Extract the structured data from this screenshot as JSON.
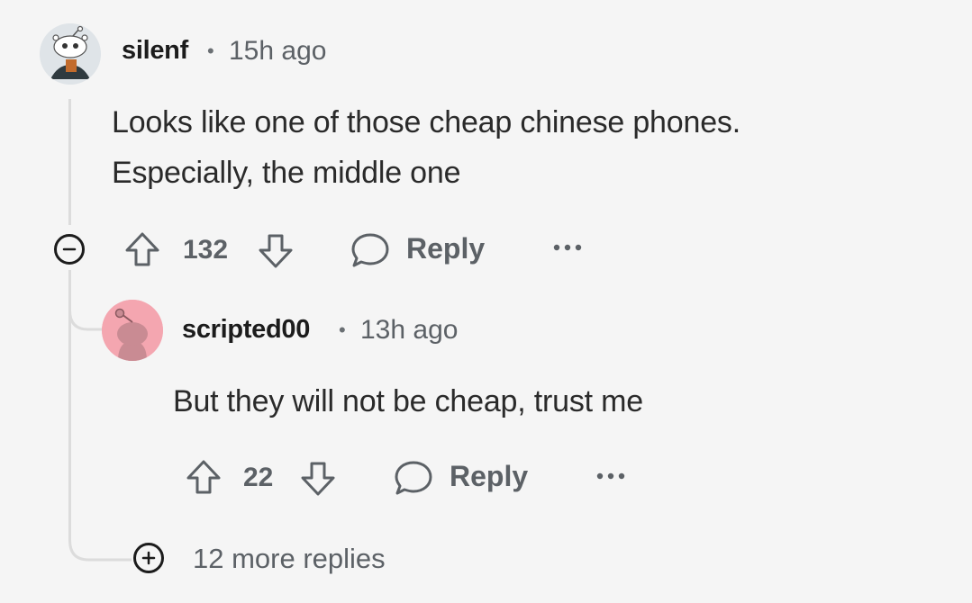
{
  "comment": {
    "username": "silenf",
    "separator": "•",
    "time": "15h ago",
    "body_lines": [
      "Looks like one of those cheap chinese phones.",
      "Especially, the middle one"
    ],
    "votes": "132",
    "reply_label": "Reply",
    "more_label": "•••"
  },
  "reply": {
    "username": "scripted00",
    "separator": "•",
    "time": "13h ago",
    "body": "But they will not be cheap, trust me",
    "votes": "22",
    "reply_label": "Reply",
    "more_label": "•••"
  },
  "more_replies": {
    "label": "12 more replies"
  },
  "colors": {
    "background": "#f5f5f5",
    "reply_avatar_bg": "#f4a6b0",
    "thread_line": "#dcdcdc",
    "muted_text": "#5c6166"
  }
}
